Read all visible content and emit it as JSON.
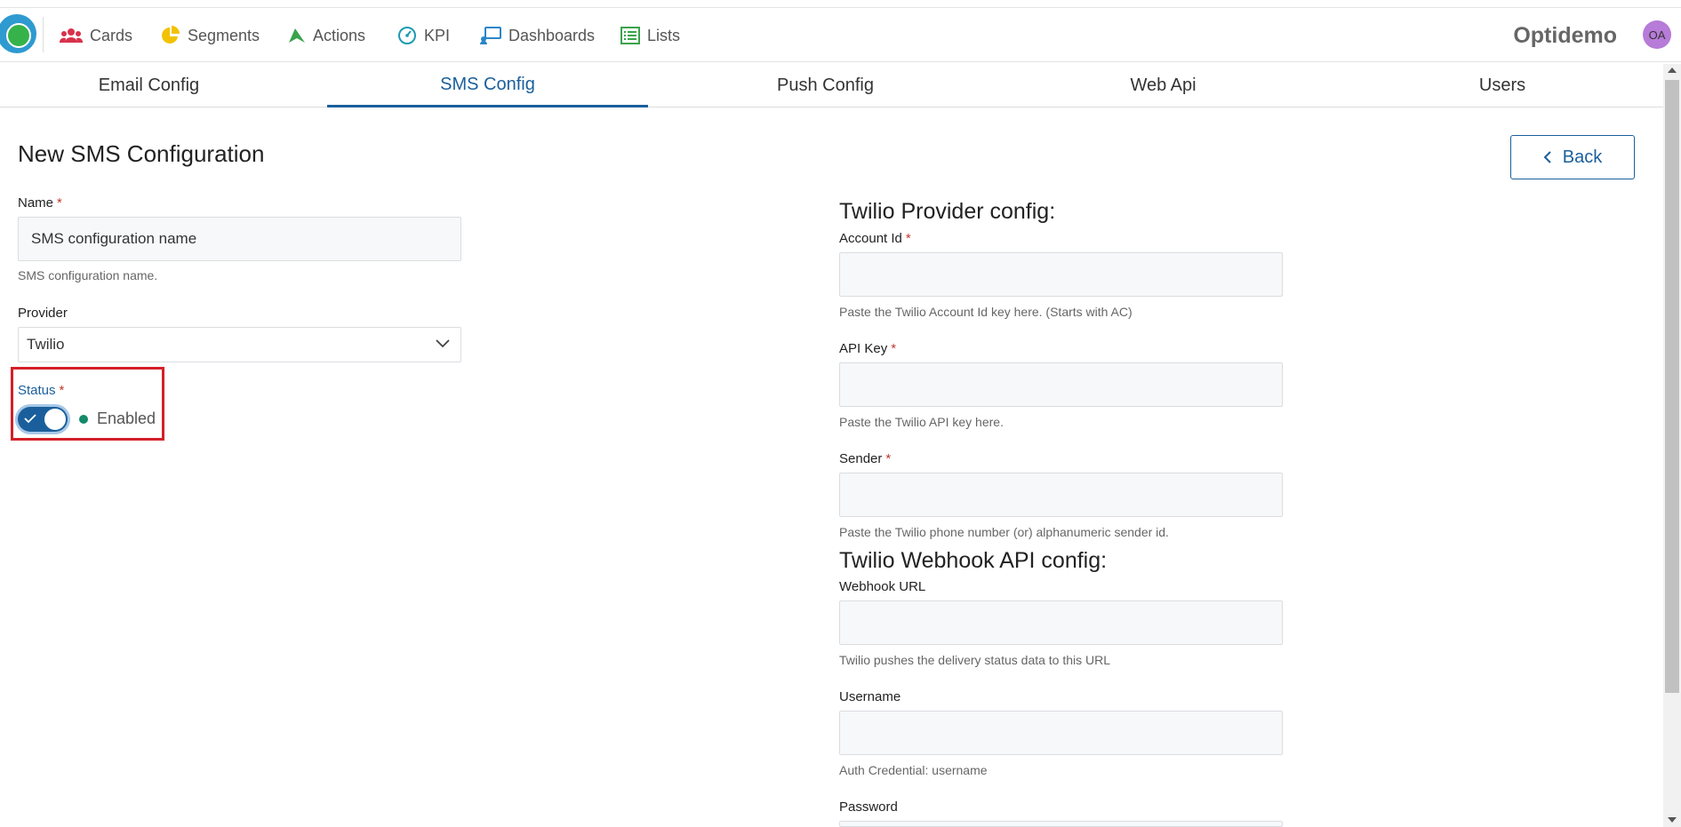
{
  "nav": {
    "items": [
      {
        "label": "Cards",
        "icon": "users-icon"
      },
      {
        "label": "Segments",
        "icon": "pie-chart-icon"
      },
      {
        "label": "Actions",
        "icon": "paper-plane-icon"
      },
      {
        "label": "KPI",
        "icon": "gauge-icon"
      },
      {
        "label": "Dashboards",
        "icon": "dashboard-icon"
      },
      {
        "label": "Lists",
        "icon": "list-icon"
      }
    ],
    "brand": "Optidemo",
    "avatar": "OA"
  },
  "tabs": [
    {
      "label": "Email Config",
      "active": false
    },
    {
      "label": "SMS Config",
      "active": true
    },
    {
      "label": "Push Config",
      "active": false
    },
    {
      "label": "Web Api",
      "active": false
    },
    {
      "label": "Users",
      "active": false
    }
  ],
  "page": {
    "title": "New SMS Configuration",
    "back_label": "Back"
  },
  "form": {
    "name_label": "Name",
    "name_value": "SMS configuration name",
    "name_hint": "SMS configuration name.",
    "provider_label": "Provider",
    "provider_value": "Twilio",
    "status_label": "Status",
    "status_value": "Enabled",
    "status_on": true,
    "required_mark": "*"
  },
  "twilio": {
    "title": "Twilio Provider config:",
    "account_id_label": "Account Id",
    "account_id_hint": "Paste the Twilio Account Id key here. (Starts with AC)",
    "api_key_label": "API Key",
    "api_key_hint": "Paste the Twilio API key here.",
    "sender_label": "Sender",
    "sender_hint": "Paste the Twilio phone number (or) alphanumeric sender id."
  },
  "webhook": {
    "title": "Twilio Webhook API config:",
    "url_label": "Webhook URL",
    "url_hint": "Twilio pushes the delivery status data to this URL",
    "username_label": "Username",
    "username_hint": "Auth Credential: username",
    "password_label": "Password"
  },
  "colors": {
    "accent": "#1a5f9c",
    "required": "#c0392b",
    "status_dot": "#138a6b",
    "highlight": "#d32029"
  }
}
